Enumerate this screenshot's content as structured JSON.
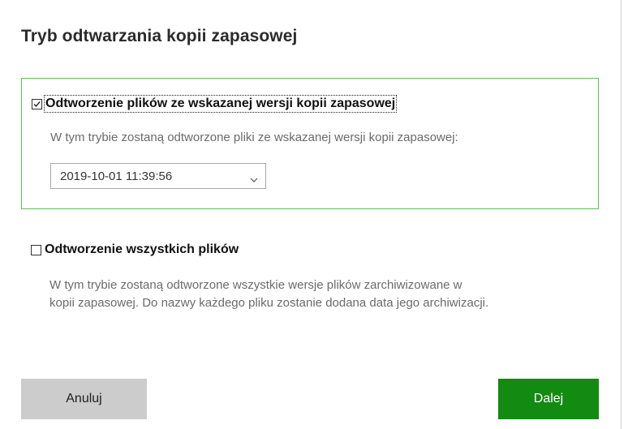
{
  "dialog": {
    "title": "Tryb odtwarzania kopii zapasowej"
  },
  "options": [
    {
      "label": "Odtworzenie plików ze wskazanej wersji kopii zapasowej",
      "checked": true,
      "description": "W tym trybie zostaną odtworzone pliki ze wskazanej wersji kopii zapasowej:",
      "version_select": {
        "selected": "2019-10-01 11:39:56"
      }
    },
    {
      "label": "Odtworzenie wszystkich plików",
      "checked": false,
      "description_line1": "W tym trybie zostaną odtworzone wszystkie wersje plików zarchiwizowane w",
      "description_line2": "kopii zapasowej. Do nazwy każdego pliku zostanie dodana data jego archiwizacji."
    }
  ],
  "buttons": {
    "cancel_label": "Anuluj",
    "next_label": "Dalej"
  },
  "colors": {
    "selected_border": "#5cbf4f",
    "primary_button": "#138a11",
    "secondary_button": "#cccccc"
  }
}
